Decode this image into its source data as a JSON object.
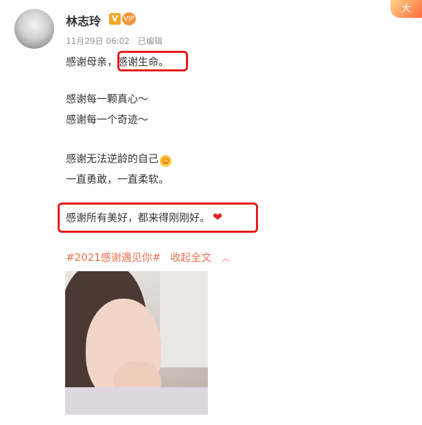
{
  "post": {
    "username": "林志玲",
    "verified_badge": "V",
    "vip_badge": "VIP",
    "corner_badge": "大",
    "timestamp": "11月29日 06:02",
    "edited": "已编辑"
  },
  "content": {
    "lines": [
      "感谢母亲，感谢生命。",
      "感谢每一颗真心～",
      "感谢每一个奇迹～",
      "感谢无法逆龄的自己",
      "一直勇敢，一直柔软。",
      "感谢所有美好，都来得刚刚好。"
    ],
    "heart_icon": "red-heart-icon",
    "smile_icon": "smiling-hearts-emoji-icon",
    "highlight_color": "#e81818",
    "link_color": "#eb7350"
  },
  "hashtag": "#2021感谢遇见你#",
  "collapse_text": "收起全文",
  "collapse_icon": "chevron-up-icon"
}
